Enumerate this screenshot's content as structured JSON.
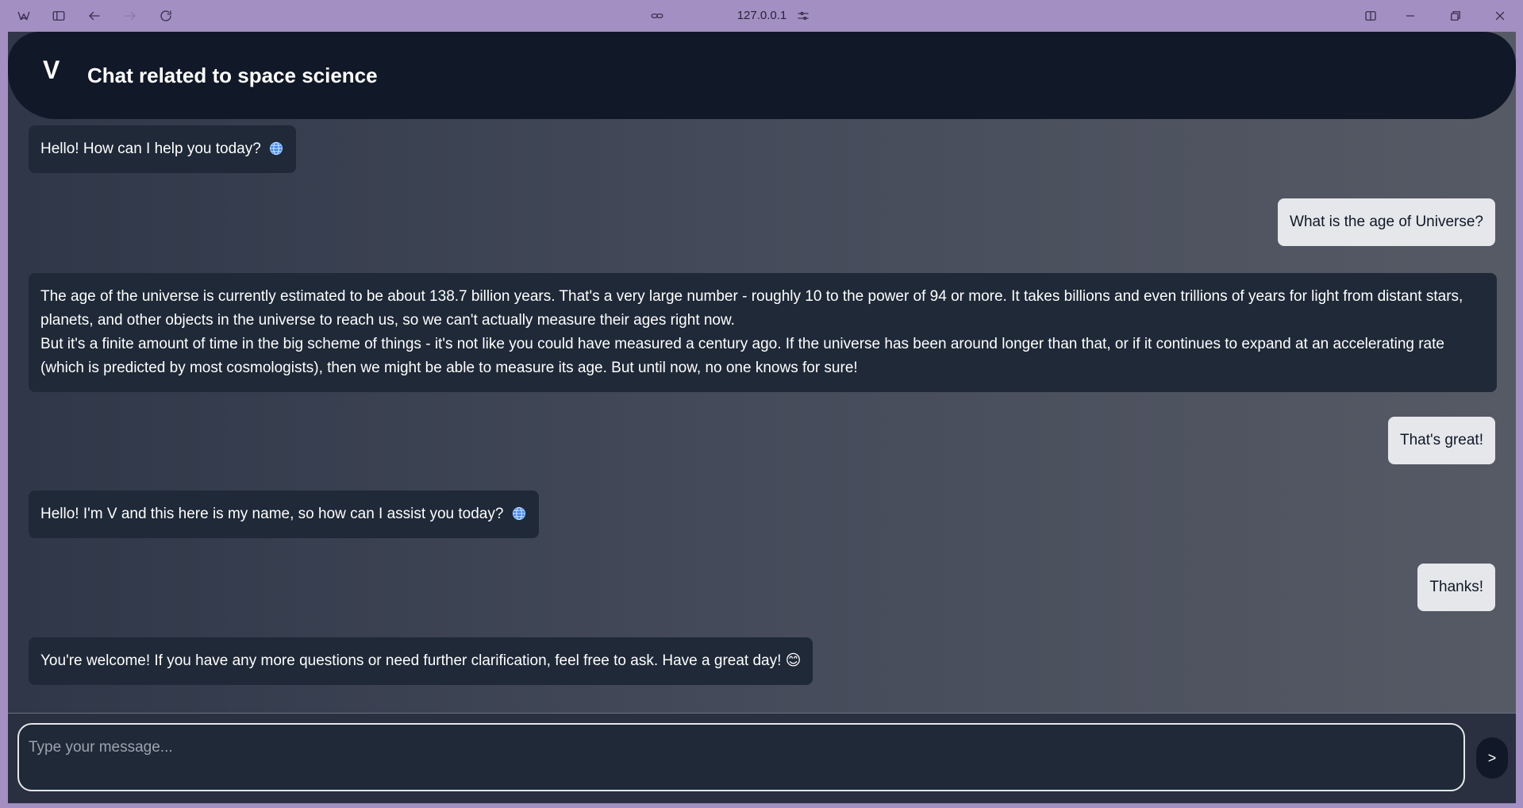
{
  "browser": {
    "address": "127.0.0.1"
  },
  "header": {
    "logo": "V",
    "title": "Chat related to space science"
  },
  "messages": [
    {
      "role": "bot",
      "text": "Hello! How can I help you today?",
      "emoji": "globe"
    },
    {
      "role": "user",
      "text": "What is the age of Universe?"
    },
    {
      "role": "bot",
      "paragraphs": [
        "The age of the universe is currently estimated to be about 138.7 billion years. That's a very large number - roughly 10 to the power of 94 or more. It takes billions and even trillions of years for light from distant stars, planets, and other objects in the universe to reach us, so we can't actually measure their ages right now.",
        "But it's a finite amount of time in the big scheme of things - it's not like you could have measured a century ago. If the universe has been around longer than that, or if it continues to expand at an accelerating rate (which is predicted by most cosmologists), then we might be able to measure its age. But until now, no one knows for sure!"
      ]
    },
    {
      "role": "user",
      "text": "That's great!"
    },
    {
      "role": "bot",
      "text": "Hello! I'm V and this here is my name, so how can I assist you today?",
      "emoji": "globe"
    },
    {
      "role": "user",
      "text": "Thanks!"
    },
    {
      "role": "bot",
      "text": "You're welcome! If you have any more questions or need further clarification, feel free to ask. Have a great day! 😊"
    }
  ],
  "composer": {
    "placeholder": "Type your message...",
    "send_label": ">"
  }
}
